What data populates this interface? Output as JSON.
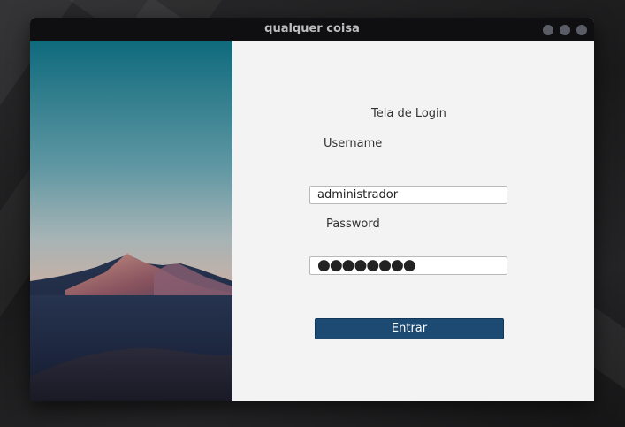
{
  "window": {
    "title": "qualquer coisa"
  },
  "login": {
    "heading": "Tela de Login",
    "username_label": "Username",
    "username_value": "administrador",
    "password_label": "Password",
    "password_value": "●●●●●●●●",
    "submit_label": "Entrar"
  },
  "colors": {
    "titlebar": "#0f0f12",
    "button": "#1c4a73",
    "form_bg": "#f3f3f3"
  }
}
